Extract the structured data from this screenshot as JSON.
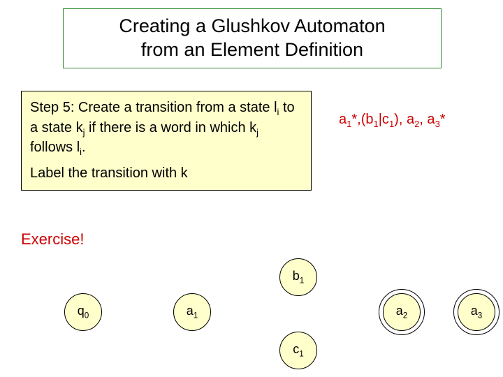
{
  "title": {
    "line1": "Creating a Glushkov Automaton",
    "line2": "from an Element Definition"
  },
  "step_box": {
    "para1_pre": "Step 5: Create a transition from a state l",
    "para1_sub1": "i",
    "para1_mid1": " to a state k",
    "para1_sub2": "j",
    "para1_mid2": " if there is a word in which k",
    "para1_sub3": "j",
    "para1_mid3": " follows l",
    "para1_sub4": "i",
    "para1_end": ".",
    "para2": "Label the transition with k"
  },
  "expression": {
    "a": "a",
    "s1": "1",
    "star1": "*,",
    "lp": "(b",
    "s2": "1",
    "pipe": "|c",
    "s3": "1",
    "rp": "),",
    "a2": " a",
    "s4": "2",
    "comma": ",",
    "a3": " a",
    "s5": "3",
    "star2": "*"
  },
  "exercise_label": "Exercise!",
  "states": {
    "q0": {
      "letter": "q",
      "sub": "0"
    },
    "a1": {
      "letter": "a",
      "sub": "1"
    },
    "b1": {
      "letter": "b",
      "sub": "1"
    },
    "c1": {
      "letter": "c",
      "sub": "1"
    },
    "a2": {
      "letter": "a",
      "sub": "2"
    },
    "a3": {
      "letter": "a",
      "sub": "3"
    }
  }
}
